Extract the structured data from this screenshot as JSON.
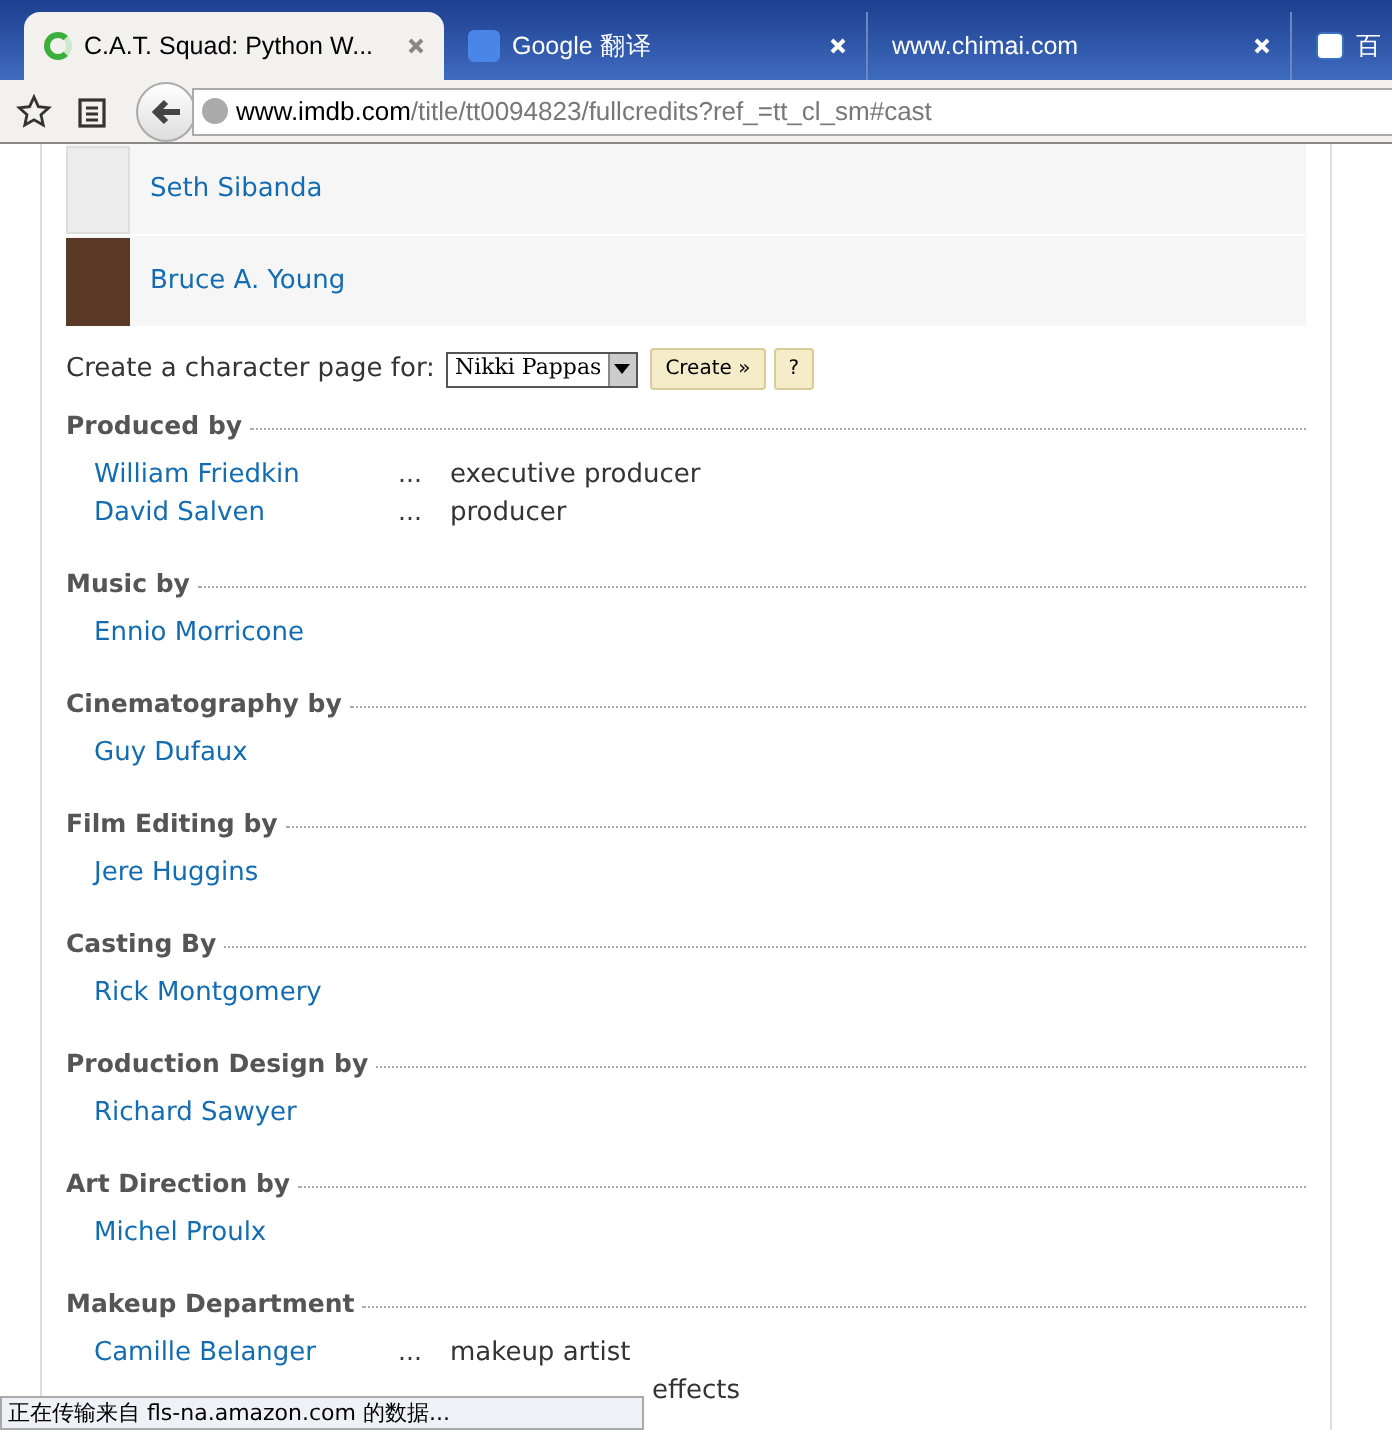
{
  "browser": {
    "tabs": [
      {
        "title": "C.A.T. Squad: Python W...",
        "selected": true,
        "kind": "loading"
      },
      {
        "title": "Google 翻译",
        "selected": false,
        "kind": "translate"
      },
      {
        "title": "www.chimai.com",
        "selected": false,
        "kind": "plain"
      },
      {
        "title": "百",
        "selected": false,
        "kind": "app"
      }
    ],
    "address": {
      "host": "www.imdb.com",
      "path": "/title/tt0094823/fullcredits?ref_=tt_cl_sm#cast"
    }
  },
  "cast": [
    {
      "name": "Seth Sibanda",
      "photo": false
    },
    {
      "name": "Bruce A. Young",
      "photo": true
    }
  ],
  "character_form": {
    "label": "Create a character page for:",
    "value": "Nikki Pappas",
    "create": "Create »",
    "help": "?"
  },
  "sections": [
    {
      "title": "Produced by",
      "rows": [
        {
          "name": "William Friedkin",
          "dots": "...",
          "role": "executive producer"
        },
        {
          "name": "David Salven",
          "dots": "...",
          "role": "producer"
        }
      ]
    },
    {
      "title": "Music by",
      "rows": [
        {
          "name": "Ennio Morricone"
        }
      ]
    },
    {
      "title": "Cinematography by",
      "rows": [
        {
          "name": "Guy Dufaux"
        }
      ]
    },
    {
      "title": "Film Editing by",
      "rows": [
        {
          "name": "Jere Huggins"
        }
      ]
    },
    {
      "title": "Casting By",
      "rows": [
        {
          "name": "Rick Montgomery"
        }
      ]
    },
    {
      "title": "Production Design by",
      "rows": [
        {
          "name": "Richard Sawyer"
        }
      ]
    },
    {
      "title": "Art Direction by",
      "rows": [
        {
          "name": "Michel Proulx"
        }
      ]
    },
    {
      "title": "Makeup Department",
      "rows": [
        {
          "name": "Camille Belanger",
          "dots": "...",
          "role": "makeup artist"
        },
        {
          "role": "effects"
        }
      ]
    }
  ],
  "status_bar": "正在传输来自 fls-na.amazon.com 的数据..."
}
